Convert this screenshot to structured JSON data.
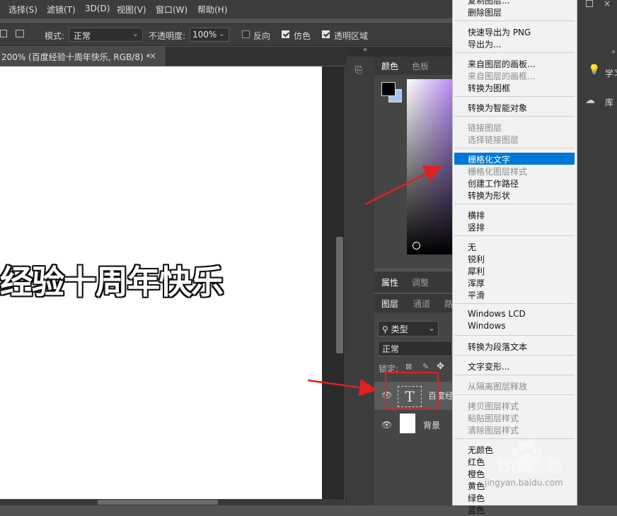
{
  "menubar": {
    "items": [
      "选择(S)",
      "滤镜(T)",
      "3D(D)",
      "视图(V)",
      "窗口(W)",
      "帮助(H)"
    ]
  },
  "options": {
    "mode_label": "模式:",
    "mode_value": "正常",
    "opacity_label": "不透明度:",
    "opacity_value": "100%",
    "reverse_label": "反向",
    "dither_label": "仿色",
    "transparency_label": "透明区域"
  },
  "document_tab": {
    "title": "200% (百度经验十周年快乐, RGB/8) *",
    "close": "×"
  },
  "canvas": {
    "text": "经验十周年快乐"
  },
  "color_panel": {
    "tabs": [
      "颜色",
      "色板"
    ],
    "fg_color": "#000000",
    "bg_color": "#a7c4ef"
  },
  "props_panel": {
    "tabs": [
      "属性",
      "调整"
    ]
  },
  "layers_panel": {
    "tabs": [
      "图层",
      "通道",
      "路"
    ],
    "filter_label": "类型",
    "blend_mode": "正常",
    "lock_label": "锁定:",
    "layers": [
      {
        "name": "百度经",
        "type": "text",
        "thumb_glyph": "T"
      },
      {
        "name": "背景",
        "type": "background"
      }
    ]
  },
  "right_dock": {
    "items": [
      "学习",
      "库"
    ]
  },
  "context_menu": {
    "items": [
      {
        "label": "复制图层...",
        "state": "enabled"
      },
      {
        "label": "删除图层",
        "state": "enabled"
      },
      {
        "sep": true
      },
      {
        "label": "快速导出为 PNG",
        "state": "enabled"
      },
      {
        "label": "导出为...",
        "state": "enabled"
      },
      {
        "sep": true
      },
      {
        "label": "来自图层的画板...",
        "state": "enabled"
      },
      {
        "label": "来自图层的画框...",
        "state": "disabled"
      },
      {
        "label": "转换为图框",
        "state": "enabled"
      },
      {
        "sep": true
      },
      {
        "label": "转换为智能对象",
        "state": "enabled"
      },
      {
        "sep": true
      },
      {
        "label": "链接图层",
        "state": "disabled"
      },
      {
        "label": "选择链接图层",
        "state": "disabled"
      },
      {
        "sep": true
      },
      {
        "label": "栅格化文字",
        "state": "highlighted"
      },
      {
        "label": "栅格化图层样式",
        "state": "disabled"
      },
      {
        "label": "创建工作路径",
        "state": "enabled"
      },
      {
        "label": "转换为形状",
        "state": "enabled"
      },
      {
        "sep": true
      },
      {
        "label": "横排",
        "state": "enabled"
      },
      {
        "label": "竖排",
        "state": "enabled"
      },
      {
        "sep": true
      },
      {
        "label": "无",
        "state": "enabled"
      },
      {
        "label": "锐利",
        "state": "enabled"
      },
      {
        "label": "犀利",
        "state": "enabled"
      },
      {
        "label": "浑厚",
        "state": "enabled"
      },
      {
        "label": "平滑",
        "state": "enabled"
      },
      {
        "sep": true
      },
      {
        "label": "Windows LCD",
        "state": "enabled"
      },
      {
        "label": "Windows",
        "state": "enabled"
      },
      {
        "sep": true
      },
      {
        "label": "转换为段落文本",
        "state": "enabled"
      },
      {
        "sep": true
      },
      {
        "label": "文字变形...",
        "state": "enabled"
      },
      {
        "sep": true
      },
      {
        "label": "从隔离图层释放",
        "state": "disabled"
      },
      {
        "sep": true
      },
      {
        "label": "拷贝图层样式",
        "state": "disabled"
      },
      {
        "label": "粘贴图层样式",
        "state": "disabled"
      },
      {
        "label": "清除图层样式",
        "state": "disabled"
      },
      {
        "sep": true
      },
      {
        "label": "无颜色",
        "state": "enabled"
      },
      {
        "label": "红色",
        "state": "enabled"
      },
      {
        "label": "橙色",
        "state": "enabled"
      },
      {
        "label": "黄色",
        "state": "enabled"
      },
      {
        "label": "绿色",
        "state": "enabled"
      },
      {
        "label": "蓝色",
        "state": "enabled"
      }
    ]
  },
  "watermark": {
    "brand": "Bai经验",
    "url": "jingyan.baidu.com"
  },
  "colors": {
    "highlight": "#0078d7",
    "annotation_red": "#e02020"
  }
}
